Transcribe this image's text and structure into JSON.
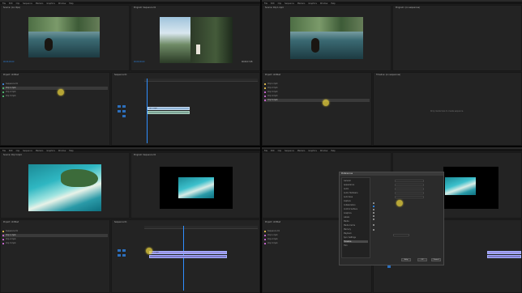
{
  "menu": [
    "File",
    "Edit",
    "Clip",
    "Sequence",
    "Markers",
    "Graphics",
    "Window",
    "Help"
  ],
  "q1": {
    "source_tab": "Source: (no clips)",
    "program_tab": "Program: Sequence 01",
    "timecode_left": "00;00;00;00",
    "timecode_right": "00;00;17;28",
    "project_tab": "Project: Untitled",
    "project_rows": [
      "Sequence 01",
      "Clip 1.mp4",
      "Clip 2.mp4",
      "Clip 3.mp4"
    ],
    "timeline_tab": "Sequence 01",
    "clip_label": "Clip 1.mp4"
  },
  "q2": {
    "source_tab": "Source: Clip 1.mp4",
    "program_tab": "Program: (no sequences)",
    "project_tab": "Project: Untitled",
    "project_rows": [
      "Clip 1.mp4",
      "Clip 2.mp4",
      "Clip 3.mp4",
      "Clip 4.mp4",
      "Clip 5.mp4"
    ],
    "timeline_tab": "Timeline: (no sequences)",
    "empty_msg": "Drop media here to create sequence."
  },
  "q3": {
    "source_tab": "Source: Clip 3.mp4",
    "program_tab": "Program: Sequence 01",
    "project_tab": "Project: Untitled",
    "project_rows": [
      "Sequence 01",
      "Clip 1.mp4",
      "Clip 2.mp4",
      "Clip 3.mp4"
    ],
    "timeline_tab": "Sequence 01",
    "clip_label": "Clip 3.mp4"
  },
  "q4": {
    "dialog_title": "Preferences",
    "categories": [
      "General",
      "Appearance",
      "Audio",
      "Audio Hardware",
      "Auto Save",
      "Capture",
      "Collaboration",
      "Control Surface",
      "Graphics",
      "Labels",
      "Media",
      "Media Cache",
      "Memory",
      "Playback",
      "Sync Settings",
      "Timeline",
      "Trim"
    ],
    "selected_category": "Timeline",
    "ok_label": "OK",
    "cancel_label": "Cancel",
    "help_label": "Help",
    "project_tab": "Project: Untitled",
    "project_rows": [
      "Sequence 01",
      "Clip 1.mp4",
      "Clip 2.mp4",
      "Clip 3.mp4"
    ]
  },
  "colors": {
    "accent_blue": "#2c7fd8",
    "clip_purple": "#9b94e6",
    "clip_blue": "#8fb3d6",
    "highlight": "#e8d23c"
  }
}
